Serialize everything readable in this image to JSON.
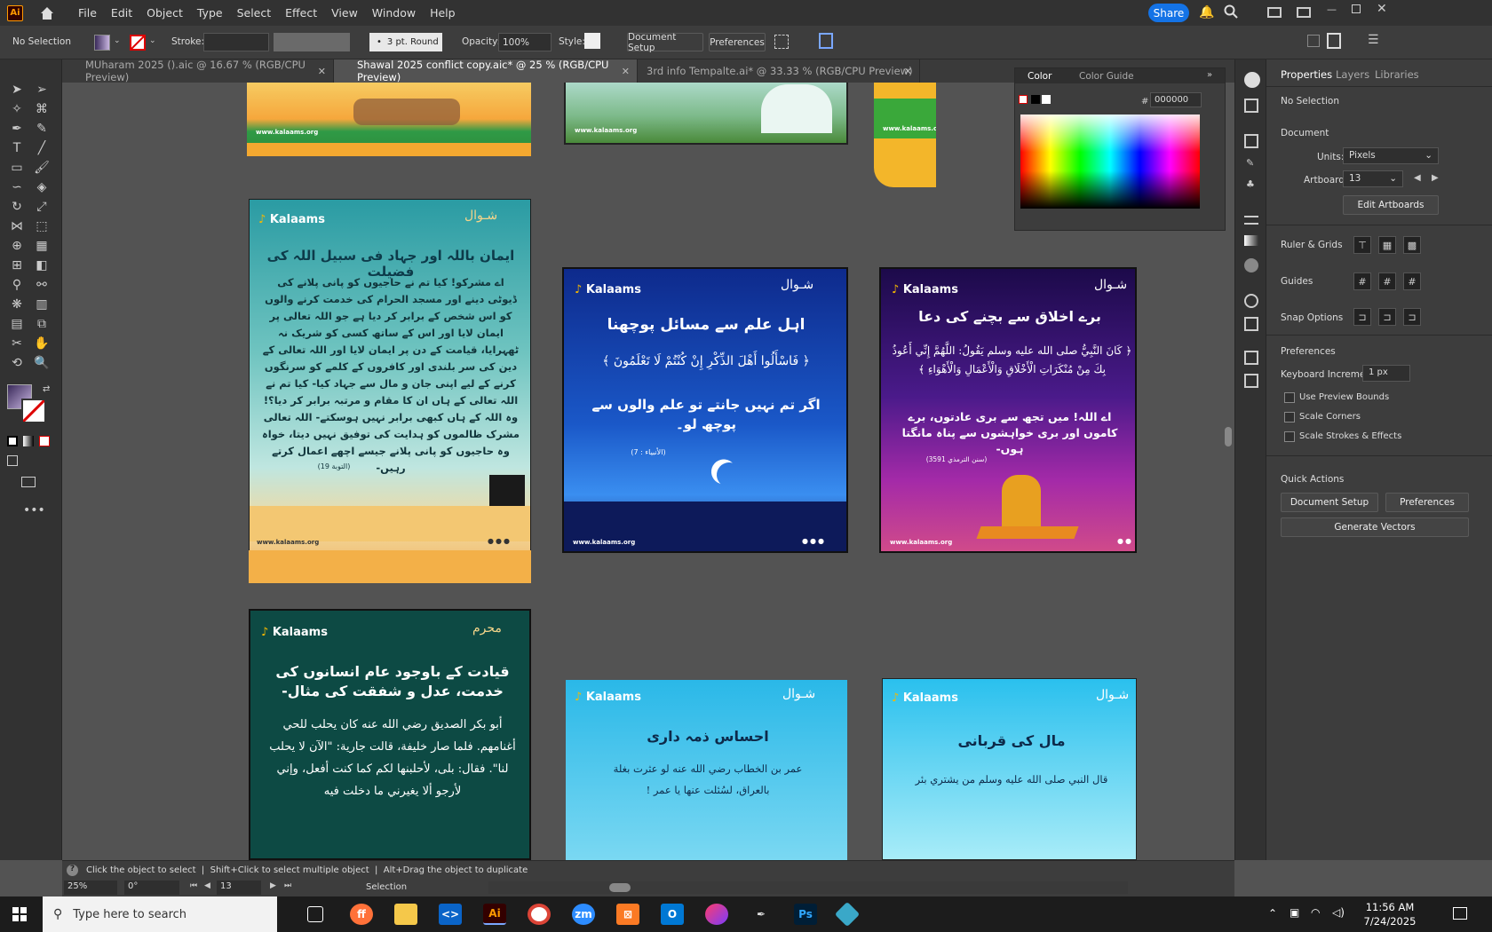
{
  "menubar": {
    "items": [
      "File",
      "Edit",
      "Object",
      "Type",
      "Select",
      "Effect",
      "View",
      "Window",
      "Help"
    ],
    "share_label": "Share"
  },
  "controlbar": {
    "selection_label": "No Selection",
    "stroke_label": "Stroke:",
    "brush_label": "3 pt. Round",
    "opacity_label": "Opacity:",
    "opacity_value": "100%",
    "style_label": "Style:",
    "document_setup_label": "Document Setup",
    "preferences_label": "Preferences"
  },
  "tabs": [
    {
      "label": "MUharam 2025 ().aic @ 16.67 % (RGB/CPU Preview)"
    },
    {
      "label": "Shawal 2025 conflict copy.aic* @ 25 % (RGB/CPU Preview)"
    },
    {
      "label": "3rd info Tempalte.ai* @ 33.33 % (RGB/CPU Preview)"
    }
  ],
  "color_panel": {
    "tab_color": "Color",
    "tab_guide": "Color Guide",
    "hex_value": "000000",
    "hash": "#"
  },
  "properties": {
    "tabs": [
      "Properties",
      "Layers",
      "Libraries"
    ],
    "no_selection": "No Selection",
    "document_heading": "Document",
    "units_label": "Units:",
    "units_value": "Pixels",
    "artboard_label": "Artboard:",
    "artboard_value": "13",
    "edit_artboards": "Edit Artboards",
    "ruler_grids": "Ruler & Grids",
    "guides": "Guides",
    "snap_options": "Snap Options",
    "preferences_heading": "Preferences",
    "keyboard_increment_label": "Keyboard Increment:",
    "keyboard_increment_value": "1 px",
    "use_preview_bounds": "Use Preview Bounds",
    "scale_corners": "Scale Corners",
    "scale_strokes": "Scale Strokes & Effects",
    "quick_actions": "Quick Actions",
    "document_setup_btn": "Document Setup",
    "preferences_btn": "Preferences",
    "generate_vectors": "Generate Vectors"
  },
  "statusbar": {
    "hint": "Click the object to select  |  Shift+Click to select multiple object  |  Alt+Drag the object to duplicate",
    "zoom": "25%",
    "rotation": "0°",
    "artboard": "13",
    "tool": "Selection"
  },
  "artboards": {
    "site": "www.kalaams.org",
    "brand": "Kalaams",
    "a1_title": "ایمان باللہ اور جہاد فی سبیل اللہ کی فضیلت",
    "a1_body": "اے مشرکو! کیا تم نے حاجیوں کو پانی پلانے کی ڈیوٹی دینے اور مسجد الحرام کی خدمت کرنے والوں کو اس شخص کے برابر کر دیا ہے جو اللہ تعالی پر ایمان لایا اور اس کے ساتھ کسی کو شریک نہ ٹھہرایا، قیامت کے دن پر ایمان لایا اور اللہ تعالی کے دین کی سر بلندی اور کافروں کے کلمے کو سرنگوں کرنے کے لیے اپنی جان و مال سے جہاد کیا- کیا تم نے اللہ تعالی کے ہاں ان کا مقام و مرتبہ برابر کر دیا؟! وہ اللہ کے ہاں کبھی برابر نہیں ہوسکتے- اللہ تعالی مشرک ظالموں کو ہدایت کی توفیق نہیں دیتا، خواہ وہ حاجیوں کو پانی پلانے جیسے اچھے اعمال کرتے رہیں-",
    "a1_ref": "(التوبة 19)",
    "a2_title": "اہل علم سے مسائل پوچھنا",
    "a2_arabic": "﴿ فَاسْأَلُوا أَهْلَ الذِّكْرِ إِنْ كُنْتُمْ لَا تَعْلَمُونَ ﴾",
    "a2_body": "اگر تم نہیں جانتے تو علم والوں سے پوچھ لو۔",
    "a2_ref": "(الأنبياء : 7)",
    "a3_title": "برے اخلاق سے بچنے کی دعا",
    "a3_arabic": "﴿ كَانَ النَّبِيُّ صلى الله عليه وسلم يَقُولُ: اللَّهُمَّ إِنِّي أَعُوذُ بِكَ مِنْ مُنْكَرَاتِ الْأَخْلَاقِ وَالْأَعْمَالِ وَالْأَهْوَاءِ ﴾",
    "a3_body": "اے اللہ! میں تجھ سے بری عادتوں، برے کاموں اور بری خواہشوں سے پناہ مانگتا ہوں-",
    "a3_ref": "(سنن الترمذي 3591)",
    "a4_title": "قیادت کے باوجود عام انسانوں کی خدمت، عدل و شفقت کی مثال-",
    "a4_body": "أبو بكر الصديق رضي الله عنه كان يحلب للحي أغنامهم. فلما صار خليفة، قالت جارية: \"الآن لا يحلب لنا\". فقال: بلى، لأحلبنها لكم كما كنت أفعل، وإني لأرجو ألا يغيرني ما دخلت فيه",
    "a5_title": "احساس ذمہ داری",
    "a5_body": "عمر بن الخطاب رضي الله عنه لو عثرت بغلة بالعراق، لسُئلت عنها يا عمر !",
    "a6_title": "مال کی قربانی",
    "a6_body": "قال النبي صلى الله عليه وسلم من يشتري بئر"
  },
  "taskbar": {
    "search_placeholder": "Type here to search",
    "time": "11:56 AM",
    "date": "7/24/2025"
  }
}
